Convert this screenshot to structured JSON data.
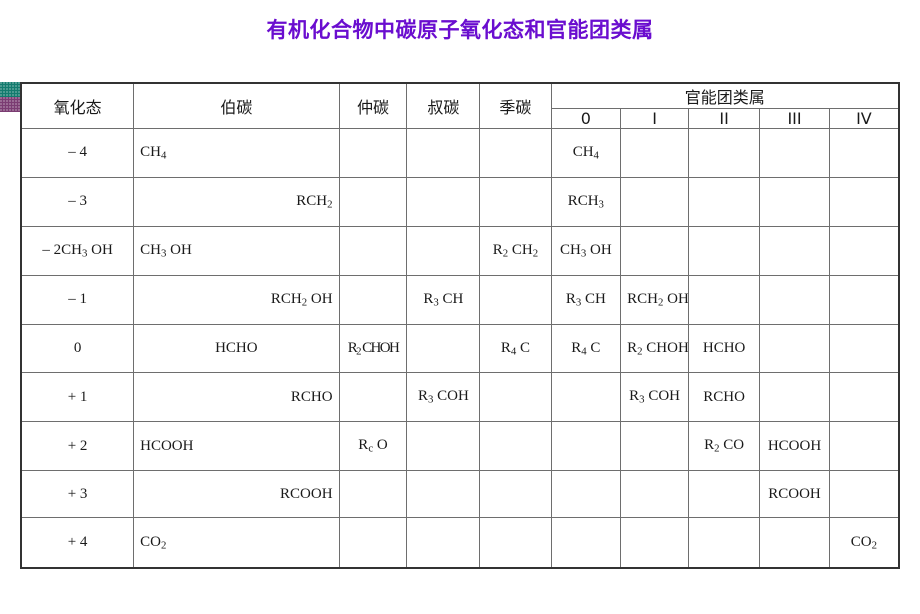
{
  "slide": {
    "title": "有机化合物中碳原子氧化态和官能团类属",
    "title_color": "#6A0DCF"
  },
  "decorations": [
    {
      "name": "teal-swatch",
      "color": "#137B6E"
    },
    {
      "name": "purple-swatch",
      "color": "#7B3C72"
    }
  ],
  "table": {
    "headers": {
      "oxidation_state": "氧化态",
      "primary_carbon": "伯碳",
      "secondary_carbon": "仲碳",
      "tertiary_carbon": "叔碳",
      "quaternary_carbon": "季碳",
      "functional_group_class": "官能团类属",
      "fg_levels": [
        "0",
        "I",
        "II",
        "III",
        "IV"
      ]
    },
    "rows": [
      {
        "oxidation_state": "– 4",
        "primary": "CH4",
        "primary_align": "left",
        "secondary": "",
        "tertiary": "",
        "quaternary": "",
        "fg": [
          "CH4",
          "",
          "",
          "",
          ""
        ]
      },
      {
        "oxidation_state": "– 3",
        "primary": "RCH2",
        "primary_align": "right",
        "secondary": "",
        "tertiary": "",
        "quaternary": "",
        "fg": [
          "RCH3",
          "",
          "",
          "",
          ""
        ]
      },
      {
        "oxidation_state": "– 2CH3 OH",
        "primary": "CH3 OH",
        "primary_align": "left",
        "secondary": "",
        "tertiary": "",
        "quaternary": "R2 CH2",
        "fg": [
          "CH3 OH",
          "",
          "",
          "",
          ""
        ]
      },
      {
        "oxidation_state": "– 1",
        "primary": "RCH2 OH",
        "primary_align": "right",
        "secondary": "",
        "tertiary": "R3 CH",
        "quaternary": "",
        "fg": [
          "R3 CH",
          "RCH2 OH",
          "",
          "",
          ""
        ]
      },
      {
        "oxidation_state": "0",
        "primary": "HCHO",
        "primary_align": "center",
        "secondary": "R2 CHOH",
        "secondary_squeeze": true,
        "tertiary": "",
        "quaternary": "R4 C",
        "fg": [
          "R4 C",
          "R2 CHOH",
          "HCHO",
          "",
          ""
        ]
      },
      {
        "oxidation_state": "+ 1",
        "primary": "RCHO",
        "primary_align": "right",
        "secondary": "",
        "tertiary": "R3 COH",
        "quaternary": "",
        "fg": [
          "",
          "R3 COH",
          "RCHO",
          "",
          ""
        ]
      },
      {
        "oxidation_state": "+ 2",
        "primary": "HCOOH",
        "primary_align": "left",
        "secondary": "Rc O",
        "tertiary": "",
        "quaternary": "",
        "fg": [
          "",
          "",
          "R2 CO",
          "HCOOH",
          ""
        ]
      },
      {
        "oxidation_state": "+ 3",
        "primary": "RCOOH",
        "primary_align": "right",
        "secondary": "",
        "tertiary": "",
        "quaternary": "",
        "fg": [
          "",
          "",
          "",
          "RCOOH",
          ""
        ]
      },
      {
        "oxidation_state": "+ 4",
        "primary": "CO2",
        "primary_align": "left",
        "secondary": "",
        "tertiary": "",
        "quaternary": "",
        "fg": [
          "",
          "",
          "",
          "",
          "CO2"
        ]
      }
    ]
  }
}
